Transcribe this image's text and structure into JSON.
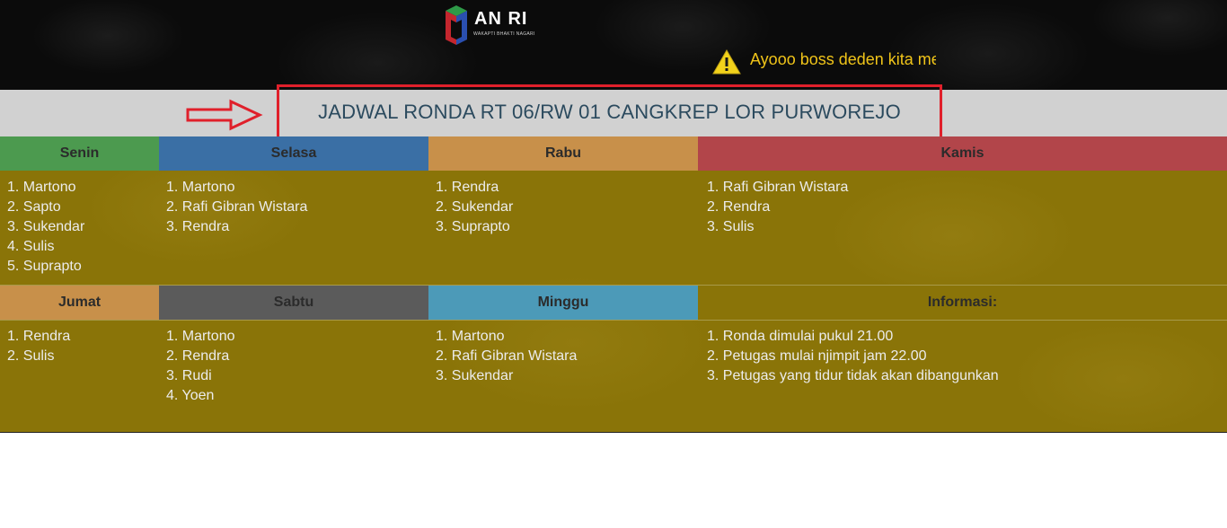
{
  "header": {
    "logo_text": "AN RI",
    "logo_subtext": "WAKAPTI BHAKTI NAGARI",
    "marquee_text": "Ayooo boss deden kita me"
  },
  "title": {
    "text": "JADWAL RONDA RT 06/RW 01 CANGKREP LOR PURWOREJO"
  },
  "colors": {
    "senin": "#4c9a4f",
    "selasa": "#3a6fa5",
    "rabu": "#c8904a",
    "kamis": "#b2454a",
    "jumat": "#c8904a",
    "sabtu": "#5b5b5b",
    "minggu": "#4c9ab8",
    "informasi": "#8a7408",
    "background": "#8a7408",
    "title_border": "#e0202b",
    "marquee_text": "#f0c419"
  },
  "schedule": {
    "senin": {
      "label": "Senin",
      "items": [
        "1. Martono",
        "2. Sapto",
        "3. Sukendar",
        "4. Sulis",
        "5. Suprapto"
      ]
    },
    "selasa": {
      "label": "Selasa",
      "items": [
        "1. Martono",
        "2. Rafi Gibran Wistara",
        "3. Rendra"
      ]
    },
    "rabu": {
      "label": "Rabu",
      "items": [
        "1. Rendra",
        "2. Sukendar",
        "3. Suprapto"
      ]
    },
    "kamis": {
      "label": "Kamis",
      "items": [
        "1. Rafi Gibran Wistara",
        "2. Rendra",
        "3. Sulis"
      ]
    },
    "jumat": {
      "label": "Jumat",
      "items": [
        "1. Rendra",
        "2. Sulis"
      ]
    },
    "sabtu": {
      "label": "Sabtu",
      "items": [
        "1. Martono",
        "2. Rendra",
        "3. Rudi",
        "4. Yoen"
      ]
    },
    "minggu": {
      "label": "Minggu",
      "items": [
        "1. Martono",
        "2. Rafi Gibran Wistara",
        "3. Sukendar"
      ]
    },
    "informasi": {
      "label": "Informasi:",
      "items": [
        "1. Ronda dimulai pukul 21.00",
        "2. Petugas mulai njimpit jam 22.00",
        "3. Petugas yang tidur tidak akan dibangunkan"
      ]
    }
  },
  "icons": {
    "logo": "logo-icon",
    "warning": "warning-icon",
    "arrow": "arrow-right-icon"
  }
}
